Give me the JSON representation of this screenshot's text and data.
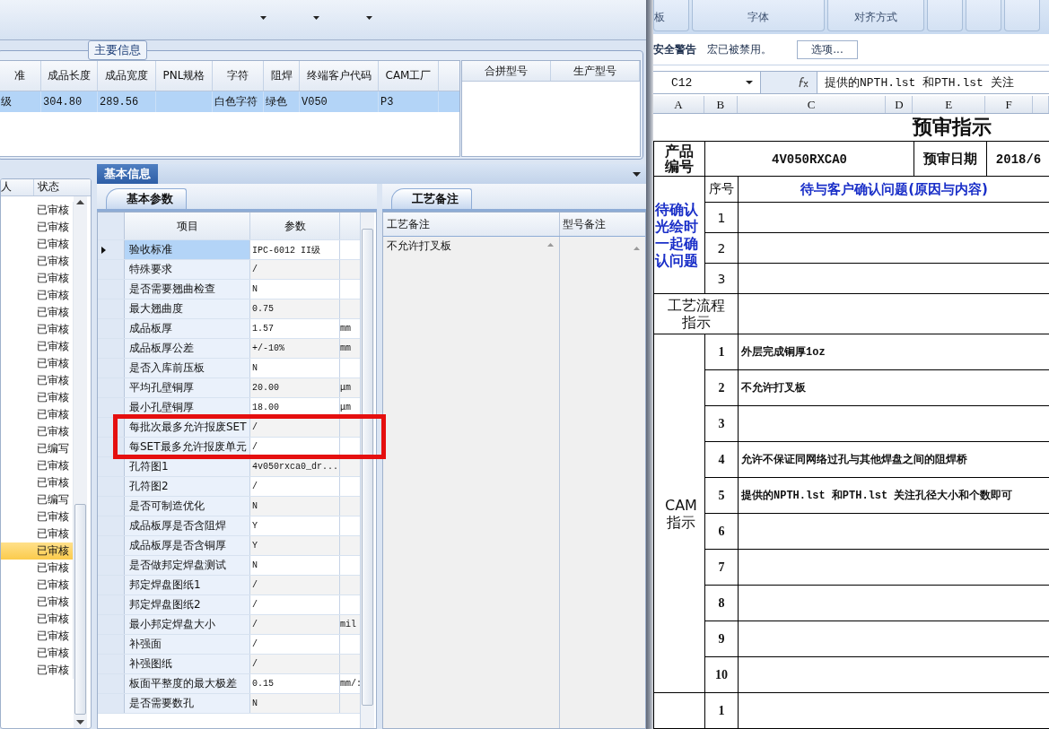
{
  "main_info": {
    "title": "主要信息",
    "columns": [
      "准",
      "成品长度",
      "成品宽度",
      "PNL规格",
      "字符",
      "阻焊",
      "终端客户代码",
      "CAM工厂"
    ],
    "rows": [
      {
        "cells": [
          "级",
          "304.80",
          "289.56",
          null,
          "白色字符",
          "绿色",
          "V050",
          "P3"
        ],
        "selected": true
      }
    ]
  },
  "merge_table": {
    "columns": [
      "合拼型号",
      "生产型号"
    ]
  },
  "list": {
    "columns": [
      "人",
      "状态"
    ],
    "rows": [
      {
        "status": "已审核",
        "selected": false
      },
      {
        "status": "已审核",
        "selected": false
      },
      {
        "status": "已审核",
        "selected": false
      },
      {
        "status": "已审核",
        "selected": false
      },
      {
        "status": "已审核",
        "selected": false
      },
      {
        "status": "已审核",
        "selected": false
      },
      {
        "status": "已审核",
        "selected": false
      },
      {
        "status": "已审核",
        "selected": false
      },
      {
        "status": "已审核",
        "selected": false
      },
      {
        "status": "已审核",
        "selected": false
      },
      {
        "status": "已审核",
        "selected": false
      },
      {
        "status": "已审核",
        "selected": false
      },
      {
        "status": "已审核",
        "selected": false
      },
      {
        "status": "已审核",
        "selected": false
      },
      {
        "status": "已编写",
        "selected": false
      },
      {
        "status": "已审核",
        "selected": false
      },
      {
        "status": "已审核",
        "selected": false
      },
      {
        "status": "已编写",
        "selected": false
      },
      {
        "status": "已审核",
        "selected": false
      },
      {
        "status": "已审核",
        "selected": false
      },
      {
        "status": "已审核",
        "selected": true
      },
      {
        "status": "已审核",
        "selected": false
      },
      {
        "status": "已审核",
        "selected": false
      },
      {
        "status": "已审核",
        "selected": false
      },
      {
        "status": "已审核",
        "selected": false
      },
      {
        "status": "已审核",
        "selected": false
      },
      {
        "status": "已审核",
        "selected": false
      },
      {
        "status": "已审核",
        "selected": false
      }
    ]
  },
  "basic_info": {
    "title": "基本信息",
    "tab": "基本参数",
    "columns": [
      "项目",
      "参数"
    ],
    "rows": [
      {
        "item": "验收标准",
        "value": "IPC-6012 II级",
        "selected": true,
        "highlighted": false
      },
      {
        "item": "特殊要求",
        "value": "/",
        "selected": false,
        "highlighted": false
      },
      {
        "item": "是否需要翘曲检查",
        "value": "N",
        "selected": false,
        "highlighted": false
      },
      {
        "item": "最大翘曲度",
        "value": "0.75",
        "selected": false,
        "highlighted": false
      },
      {
        "item": "成品板厚",
        "value": "1.57",
        "unit": "mm",
        "selected": false,
        "highlighted": false
      },
      {
        "item": "成品板厚公差",
        "value": "+/-10%",
        "unit": "mm",
        "selected": false,
        "highlighted": false
      },
      {
        "item": "是否入库前压板",
        "value": "N",
        "selected": false,
        "highlighted": false
      },
      {
        "item": "平均孔壁铜厚",
        "value": "20.00",
        "unit": "μm",
        "selected": false,
        "highlighted": false
      },
      {
        "item": "最小孔壁铜厚",
        "value": "18.00",
        "unit": "μm",
        "selected": false,
        "highlighted": false
      },
      {
        "item": "每批次最多允许报废SET",
        "value": "/",
        "selected": false,
        "highlighted": true
      },
      {
        "item": "每SET最多允许报废单元",
        "value": "/",
        "selected": false,
        "highlighted": true
      },
      {
        "item": "孔符图1",
        "value": "4v050rxca0_dr...",
        "selected": false,
        "highlighted": false
      },
      {
        "item": "孔符图2",
        "value": "/",
        "selected": false,
        "highlighted": false
      },
      {
        "item": "是否可制造优化",
        "value": "N",
        "selected": false,
        "highlighted": false
      },
      {
        "item": "成品板厚是否含阻焊",
        "value": "Y",
        "selected": false,
        "highlighted": false
      },
      {
        "item": "成品板厚是否含铜厚",
        "value": "Y",
        "selected": false,
        "highlighted": false
      },
      {
        "item": "是否做邦定焊盘测试",
        "value": "N",
        "selected": false,
        "highlighted": false
      },
      {
        "item": "邦定焊盘图纸1",
        "value": "/",
        "selected": false,
        "highlighted": false
      },
      {
        "item": "邦定焊盘图纸2",
        "value": "/",
        "selected": false,
        "highlighted": false
      },
      {
        "item": "最小邦定焊盘大小",
        "value": "/",
        "unit": "mil",
        "selected": false,
        "highlighted": false
      },
      {
        "item": "补强面",
        "value": "/",
        "selected": false,
        "highlighted": false
      },
      {
        "item": "补强图纸",
        "value": "/",
        "selected": false,
        "highlighted": false
      },
      {
        "item": "板面平整度的最大极差",
        "value": "0.15",
        "unit": "mm/:",
        "selected": false,
        "highlighted": false
      },
      {
        "item": "是否需要数孔",
        "value": "N",
        "selected": false,
        "highlighted": false
      }
    ]
  },
  "process_notes": {
    "tab": "工艺备注",
    "columns": [
      "工艺备注",
      "型号备注"
    ],
    "text": "不允许打叉板"
  },
  "excel": {
    "ribbon_groups": [
      "板",
      "字体",
      "对齐方式"
    ],
    "security": {
      "title": "安全警告",
      "message": "宏已被禁用。",
      "button": "选项..."
    },
    "name_box": "C12",
    "formula": "提供的NPTH.lst 和PTH.lst 关注",
    "columns": [
      "A",
      "B",
      "C",
      "D",
      "E",
      "F"
    ],
    "sheet": {
      "title": "预审指示",
      "product_label": "产品编号",
      "product": "4V050RXCA0",
      "date_label": "预审日期",
      "date": "2018/6",
      "confirm": {
        "label": "待确认光绘时一起确认问题",
        "no_header": "序号",
        "header": "待与客户确认问题(原因与内容)",
        "rows": [
          "1",
          "2",
          "3"
        ]
      },
      "process_label": "工艺流程指示",
      "cam": {
        "label": "CAM指示",
        "rows": [
          {
            "no": "1",
            "text": "外层完成铜厚1oz"
          },
          {
            "no": "2",
            "text": "不允许打叉板"
          },
          {
            "no": "3"
          },
          {
            "no": "4",
            "text": "允许不保证同网络过孔与其他焊盘之间的阻焊桥"
          },
          {
            "no": "5",
            "text": "提供的NPTH.lst  和PTH.lst  关注孔径大小和个数即可"
          },
          {
            "no": "6"
          },
          {
            "no": "7"
          },
          {
            "no": "8"
          },
          {
            "no": "9"
          },
          {
            "no": "10"
          }
        ]
      },
      "next_rows": [
        "1"
      ]
    }
  }
}
